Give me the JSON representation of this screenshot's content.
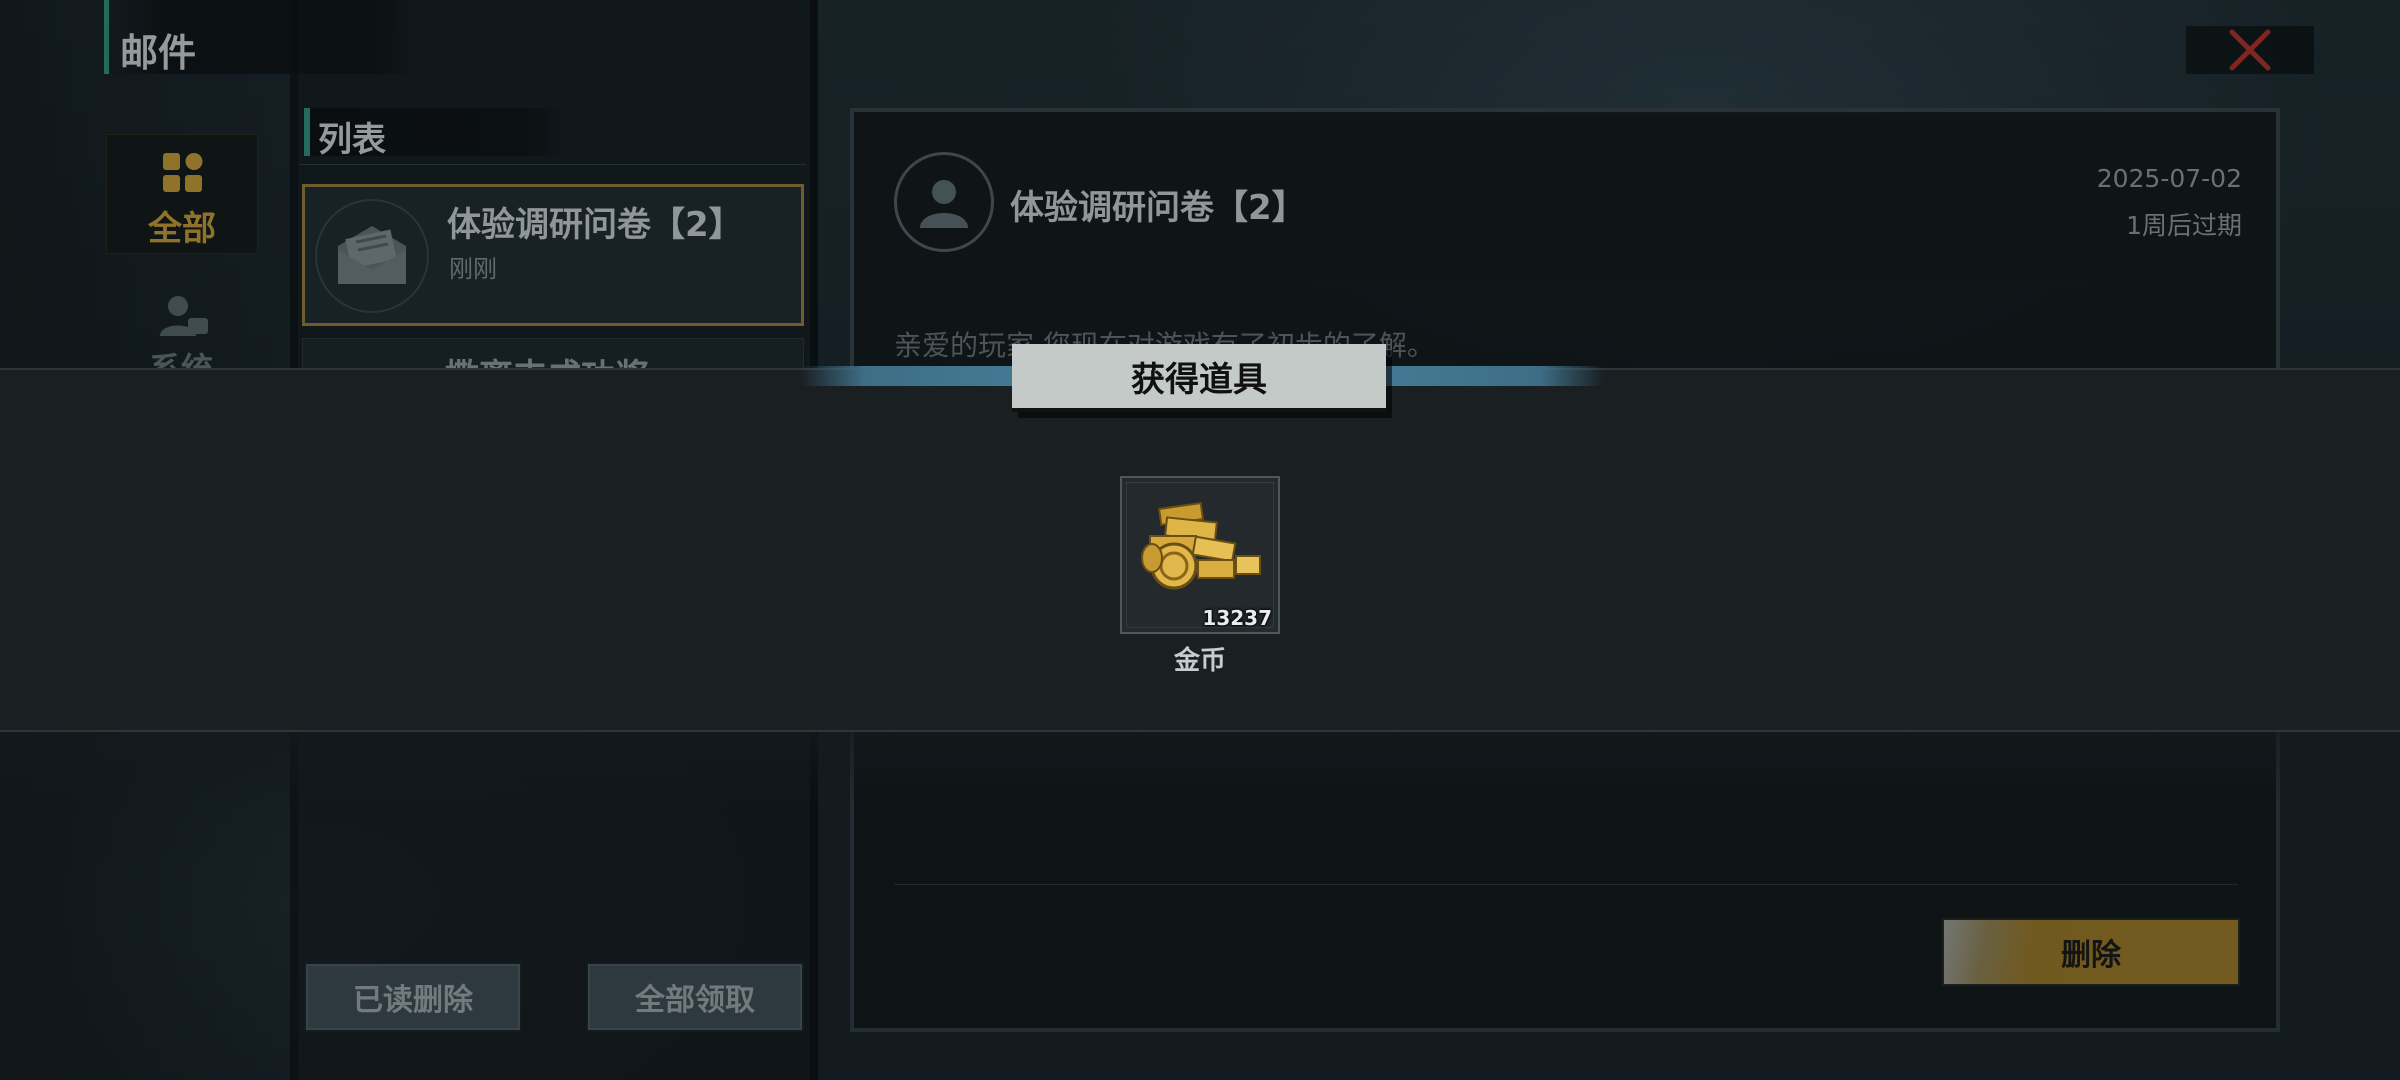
{
  "header": {
    "title": "邮件"
  },
  "categories": [
    {
      "label": "全部",
      "icon": "grid-icon",
      "active": true
    },
    {
      "label": "系统",
      "icon": "user-icon",
      "active": false
    }
  ],
  "list": {
    "title": "列表",
    "items": [
      {
        "title": "体验调研问卷【2】",
        "time": "刚刚",
        "selected": true
      },
      {
        "title": "撒离丰成功奖",
        "time": "",
        "selected": false
      }
    ],
    "buttons": {
      "delete_read": "已读删除",
      "claim_all": "全部领取"
    }
  },
  "detail": {
    "title": "体验调研问卷【2】",
    "date": "2025-07-02",
    "expire": "1周后过期",
    "body": "亲爱的玩家,您现在对游戏有了初步的了解。",
    "delete_button": "删除"
  },
  "reward_popup": {
    "title": "获得道具",
    "items": [
      {
        "name": "金币",
        "count": "13237",
        "icon": "gold-coins-icon"
      }
    ]
  },
  "colors": {
    "accent_gold": "#d8a83a",
    "accent_teal": "#2e9b86",
    "close_red": "#c0302a"
  }
}
